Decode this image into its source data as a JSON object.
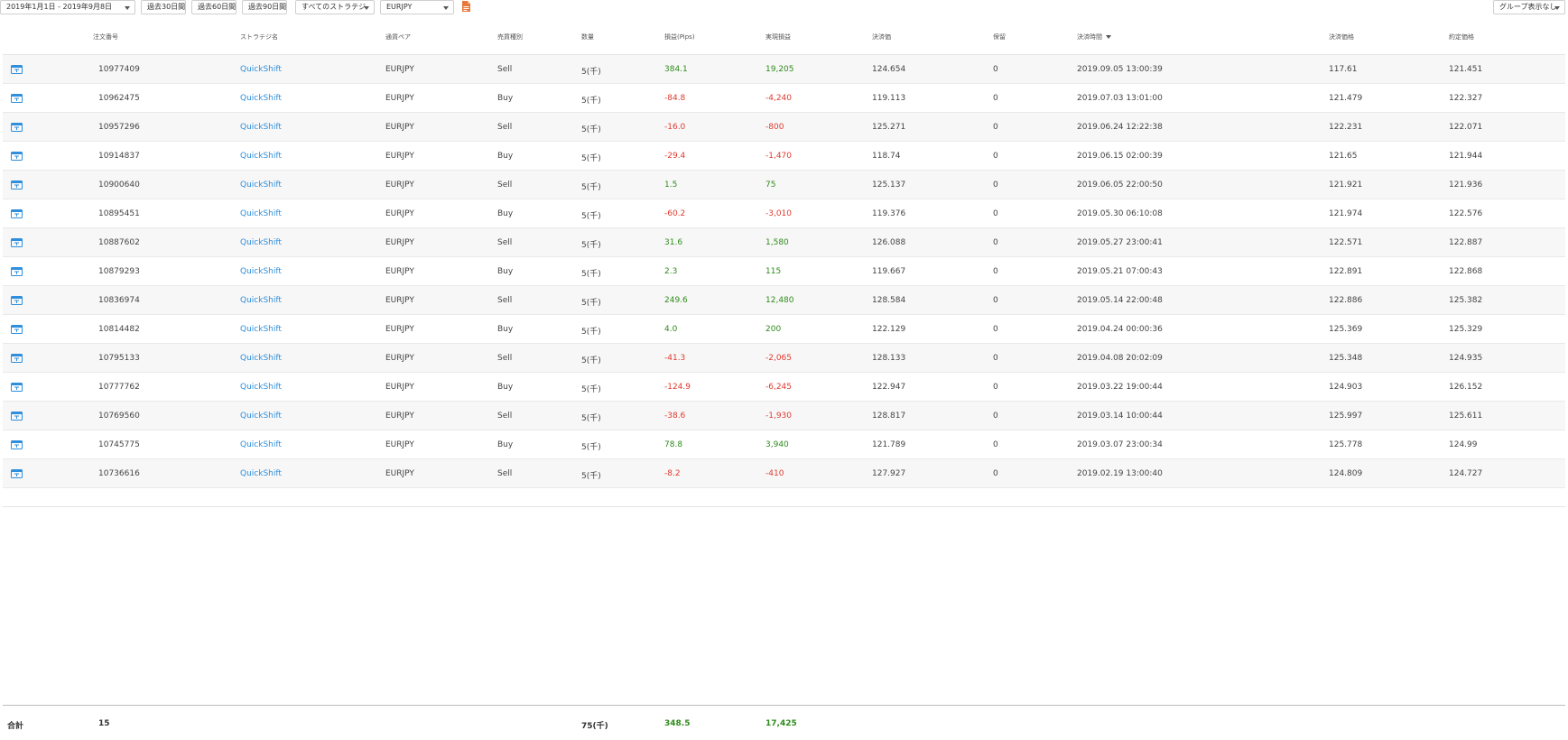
{
  "toolbar": {
    "date_range": "2019年1月1日 - 2019年9月8日",
    "btn_30": "過去30日間",
    "btn_60": "過去60日間",
    "btn_90": "過去90日間",
    "strategy_select": "すべてのストラテジ",
    "pair_select": "EURJPY",
    "group_select": "グループ表示なし"
  },
  "colors": {
    "positive": "#2e8b1a",
    "negative": "#e03a2f",
    "link": "#2f8fdc",
    "icon": "#2f8fdc",
    "pdf_icon": "#e8793a"
  },
  "icons": {
    "detail": "detail-icon",
    "export": "pdf-icon",
    "sort": "sort-desc-icon"
  },
  "table": {
    "headers": {
      "order_no": "注文番号",
      "strategy": "ストラテジ名",
      "pair": "通貨ペア",
      "side": "売買種別",
      "qty": "数量",
      "pips": "損益(Pips)",
      "realized": "実現損益",
      "rollover": "決済価",
      "fee": "保留",
      "settle_time": "決済時間",
      "settle_price": "決済価格",
      "exec_price": "約定価格"
    },
    "rows": [
      {
        "order_no": "10977409",
        "strategy": "QuickShift",
        "pair": "EURJPY",
        "side": "Sell",
        "qty": "5(千)",
        "pips": "384.1",
        "realized": "19,205",
        "rollover": "124.654",
        "fee": "0",
        "settle_time": "2019.09.05 13:00:39",
        "settle_price": "117.61",
        "exec_price": "121.451"
      },
      {
        "order_no": "10962475",
        "strategy": "QuickShift",
        "pair": "EURJPY",
        "side": "Buy",
        "qty": "5(千)",
        "pips": "-84.8",
        "realized": "-4,240",
        "rollover": "119.113",
        "fee": "0",
        "settle_time": "2019.07.03 13:01:00",
        "settle_price": "121.479",
        "exec_price": "122.327"
      },
      {
        "order_no": "10957296",
        "strategy": "QuickShift",
        "pair": "EURJPY",
        "side": "Sell",
        "qty": "5(千)",
        "pips": "-16.0",
        "realized": "-800",
        "rollover": "125.271",
        "fee": "0",
        "settle_time": "2019.06.24 12:22:38",
        "settle_price": "122.231",
        "exec_price": "122.071"
      },
      {
        "order_no": "10914837",
        "strategy": "QuickShift",
        "pair": "EURJPY",
        "side": "Buy",
        "qty": "5(千)",
        "pips": "-29.4",
        "realized": "-1,470",
        "rollover": "118.74",
        "fee": "0",
        "settle_time": "2019.06.15 02:00:39",
        "settle_price": "121.65",
        "exec_price": "121.944"
      },
      {
        "order_no": "10900640",
        "strategy": "QuickShift",
        "pair": "EURJPY",
        "side": "Sell",
        "qty": "5(千)",
        "pips": "1.5",
        "realized": "75",
        "rollover": "125.137",
        "fee": "0",
        "settle_time": "2019.06.05 22:00:50",
        "settle_price": "121.921",
        "exec_price": "121.936"
      },
      {
        "order_no": "10895451",
        "strategy": "QuickShift",
        "pair": "EURJPY",
        "side": "Buy",
        "qty": "5(千)",
        "pips": "-60.2",
        "realized": "-3,010",
        "rollover": "119.376",
        "fee": "0",
        "settle_time": "2019.05.30 06:10:08",
        "settle_price": "121.974",
        "exec_price": "122.576"
      },
      {
        "order_no": "10887602",
        "strategy": "QuickShift",
        "pair": "EURJPY",
        "side": "Sell",
        "qty": "5(千)",
        "pips": "31.6",
        "realized": "1,580",
        "rollover": "126.088",
        "fee": "0",
        "settle_time": "2019.05.27 23:00:41",
        "settle_price": "122.571",
        "exec_price": "122.887"
      },
      {
        "order_no": "10879293",
        "strategy": "QuickShift",
        "pair": "EURJPY",
        "side": "Buy",
        "qty": "5(千)",
        "pips": "2.3",
        "realized": "115",
        "rollover": "119.667",
        "fee": "0",
        "settle_time": "2019.05.21 07:00:43",
        "settle_price": "122.891",
        "exec_price": "122.868"
      },
      {
        "order_no": "10836974",
        "strategy": "QuickShift",
        "pair": "EURJPY",
        "side": "Sell",
        "qty": "5(千)",
        "pips": "249.6",
        "realized": "12,480",
        "rollover": "128.584",
        "fee": "0",
        "settle_time": "2019.05.14 22:00:48",
        "settle_price": "122.886",
        "exec_price": "125.382"
      },
      {
        "order_no": "10814482",
        "strategy": "QuickShift",
        "pair": "EURJPY",
        "side": "Buy",
        "qty": "5(千)",
        "pips": "4.0",
        "realized": "200",
        "rollover": "122.129",
        "fee": "0",
        "settle_time": "2019.04.24 00:00:36",
        "settle_price": "125.369",
        "exec_price": "125.329"
      },
      {
        "order_no": "10795133",
        "strategy": "QuickShift",
        "pair": "EURJPY",
        "side": "Sell",
        "qty": "5(千)",
        "pips": "-41.3",
        "realized": "-2,065",
        "rollover": "128.133",
        "fee": "0",
        "settle_time": "2019.04.08 20:02:09",
        "settle_price": "125.348",
        "exec_price": "124.935"
      },
      {
        "order_no": "10777762",
        "strategy": "QuickShift",
        "pair": "EURJPY",
        "side": "Buy",
        "qty": "5(千)",
        "pips": "-124.9",
        "realized": "-6,245",
        "rollover": "122.947",
        "fee": "0",
        "settle_time": "2019.03.22 19:00:44",
        "settle_price": "124.903",
        "exec_price": "126.152"
      },
      {
        "order_no": "10769560",
        "strategy": "QuickShift",
        "pair": "EURJPY",
        "side": "Sell",
        "qty": "5(千)",
        "pips": "-38.6",
        "realized": "-1,930",
        "rollover": "128.817",
        "fee": "0",
        "settle_time": "2019.03.14 10:00:44",
        "settle_price": "125.997",
        "exec_price": "125.611"
      },
      {
        "order_no": "10745775",
        "strategy": "QuickShift",
        "pair": "EURJPY",
        "side": "Buy",
        "qty": "5(千)",
        "pips": "78.8",
        "realized": "3,940",
        "rollover": "121.789",
        "fee": "0",
        "settle_time": "2019.03.07 23:00:34",
        "settle_price": "125.778",
        "exec_price": "124.99"
      },
      {
        "order_no": "10736616",
        "strategy": "QuickShift",
        "pair": "EURJPY",
        "side": "Sell",
        "qty": "5(千)",
        "pips": "-8.2",
        "realized": "-410",
        "rollover": "127.927",
        "fee": "0",
        "settle_time": "2019.02.19 13:00:40",
        "settle_price": "124.809",
        "exec_price": "124.727"
      }
    ]
  },
  "totals": {
    "label": "合計",
    "count": "15",
    "qty": "75(千)",
    "pips": "348.5",
    "realized": "17,425"
  }
}
